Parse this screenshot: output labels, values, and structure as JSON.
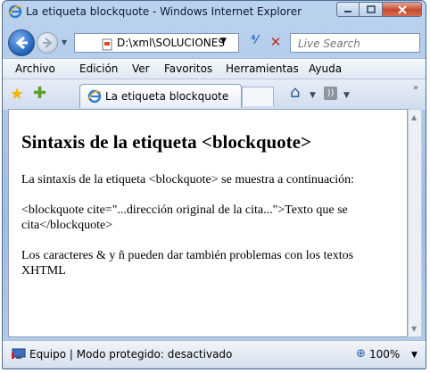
{
  "window": {
    "title": "La etiqueta blockquote - Windows Internet Explorer"
  },
  "address_bar": {
    "url": "D:\\xml\\SOLUCIONES",
    "search_placeholder": "Live Search"
  },
  "menu": {
    "items": [
      "Archivo",
      "Edición",
      "Ver",
      "Favoritos",
      "Herramientas",
      "Ayuda"
    ]
  },
  "tab": {
    "label": "La etiqueta blockquote"
  },
  "page": {
    "heading": "Sintaxis de la etiqueta <blockquote>",
    "paragraphs": [
      "La sintaxis de la etiqueta <blockquote> se muestra a continuación:",
      "<blockquote cite=\"...dirección original de la cita...\">Texto que se cita</blockquote>",
      "Los caracteres & y ñ pueden dar también problemas con los textos XHTML"
    ]
  },
  "status": {
    "text": "Equipo | Modo protegido: desactivado",
    "zoom": "100%"
  },
  "colors": {
    "frame": "#9fbde4",
    "close_button": "#c44a2f",
    "favorites_star": "#f2b400"
  },
  "icons": [
    "ie-logo-icon",
    "back-arrow-icon",
    "forward-arrow-icon",
    "refresh-icon",
    "stop-icon",
    "favorites-star-icon",
    "add-favorite-icon",
    "home-icon",
    "feeds-icon",
    "computer-icon",
    "zoom-icon"
  ]
}
